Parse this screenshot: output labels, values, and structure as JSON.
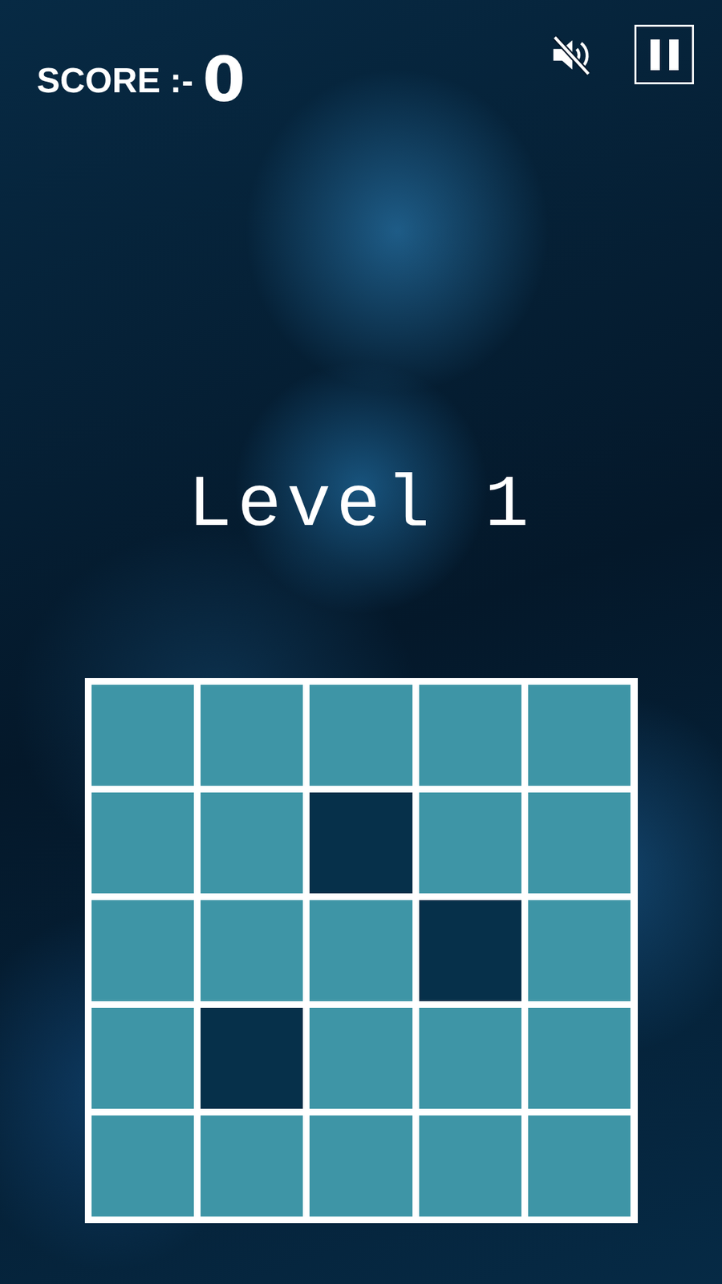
{
  "score": {
    "label": "SCORE :-",
    "value": "0"
  },
  "sound": {
    "muted": true
  },
  "level": "Level 1",
  "grid": {
    "rows": [
      [
        {
          "dark": false
        },
        {
          "dark": false
        },
        {
          "dark": false
        },
        {
          "dark": false
        },
        {
          "dark": false
        }
      ],
      [
        {
          "dark": false
        },
        {
          "dark": false
        },
        {
          "dark": true
        },
        {
          "dark": false
        },
        {
          "dark": false
        }
      ],
      [
        {
          "dark": false
        },
        {
          "dark": false
        },
        {
          "dark": false
        },
        {
          "dark": true
        },
        {
          "dark": false
        }
      ],
      [
        {
          "dark": false
        },
        {
          "dark": true
        },
        {
          "dark": false
        },
        {
          "dark": false
        },
        {
          "dark": false
        }
      ],
      [
        {
          "dark": false
        },
        {
          "dark": false
        },
        {
          "dark": false
        },
        {
          "dark": false
        },
        {
          "dark": false
        }
      ]
    ]
  }
}
